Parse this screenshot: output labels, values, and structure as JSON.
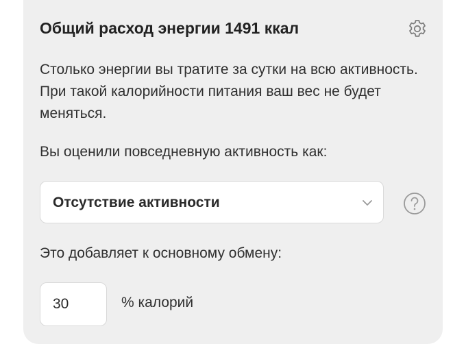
{
  "card": {
    "title": "Общий расход энергии 1491 ккал",
    "settings_icon": "gear-icon",
    "description": "Столько энергии вы тратите за сутки на всю активность. При такой калорийности питания ваш вес не будет меняться.",
    "activity_label": "Вы оценили повседневную активность как:",
    "activity_select": {
      "value": "Отсутствие активности",
      "icon": "chevron-down-icon"
    },
    "help_icon": "question-circle-icon",
    "adds_label": "Это добавляет к основному обмену:",
    "percent_input": {
      "value": "30"
    },
    "percent_unit": "% калорий"
  },
  "colors": {
    "card_background": "#efefef",
    "text": "#2f2f2f",
    "icon": "#8a8a8a",
    "input_border": "#d9d9d9"
  }
}
